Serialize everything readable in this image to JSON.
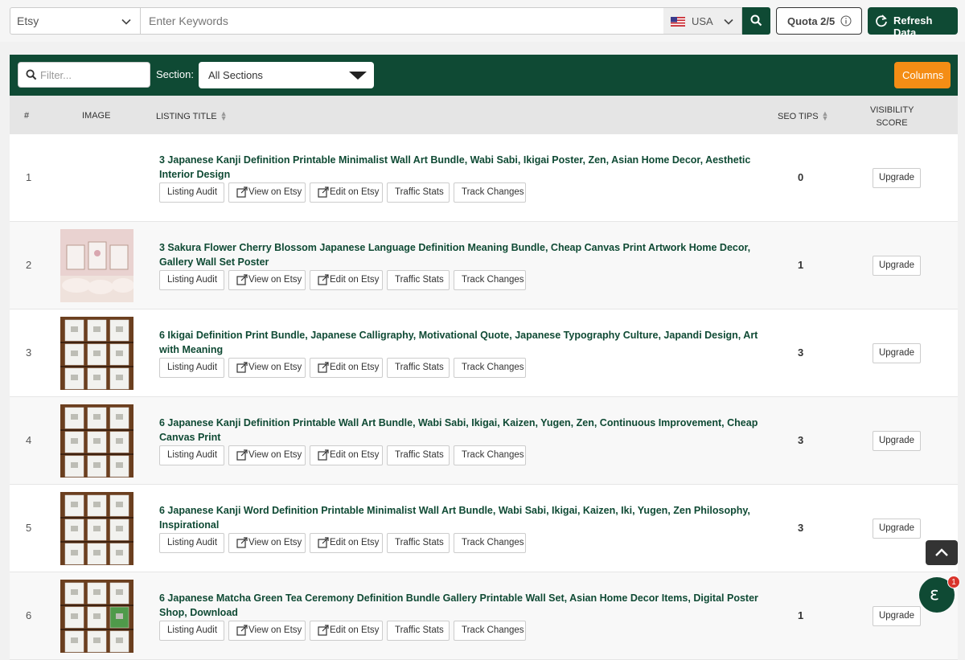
{
  "search": {
    "platform": "Etsy",
    "keyword_placeholder": "Enter Keywords",
    "country": "USA",
    "quota": "Quota 2/5",
    "refresh_label": "Refresh Data"
  },
  "toolbar": {
    "filter_placeholder": "Filter...",
    "section_label": "Section:",
    "section_value": "All Sections",
    "columns_label": "Columns"
  },
  "table": {
    "headers": {
      "num": "#",
      "image": "IMAGE",
      "title": "LISTING TITLE",
      "seo": "SEO TIPS",
      "visibility_line1": "VISIBILITY",
      "visibility_line2": "SCORE"
    },
    "button_labels": {
      "audit": "Listing Audit",
      "view": "View on Etsy",
      "edit": "Edit on Etsy",
      "traffic": "Traffic Stats",
      "track": "Track Changes",
      "upgrade": "Upgrade"
    },
    "rows": [
      {
        "num": "1",
        "title": "3 Japanese Kanji Definition Printable Minimalist Wall Art Bundle, Wabi Sabi, Ikigai Poster, Zen, Asian Home Decor, Aesthetic Interior Design",
        "seo": "0",
        "image": "none"
      },
      {
        "num": "2",
        "title": "3 Sakura Flower Cherry Blossom Japanese Language Definition Meaning Bundle, Cheap Canvas Print Artwork Home Decor, Gallery Wall Set Poster",
        "seo": "1",
        "image": "pink-room"
      },
      {
        "num": "3",
        "title": "6 Ikigai Definition Print Bundle, Japanese Calligraphy, Motivational Quote, Japanese Typography Culture, Japandi Design, Art with Meaning",
        "seo": "3",
        "image": "shelf-prints"
      },
      {
        "num": "4",
        "title": "6 Japanese Kanji Definition Printable Wall Art Bundle, Wabi Sabi, Ikigai, Kaizen, Yugen, Zen, Continuous Improvement, Cheap Canvas Print",
        "seo": "3",
        "image": "shelf-prints"
      },
      {
        "num": "5",
        "title": "6 Japanese Kanji Word Definition Printable Minimalist Wall Art Bundle, Wabi Sabi, Ikigai, Kaizen, Iki, Yugen, Zen Philosophy, Inspirational",
        "seo": "3",
        "image": "shelf-prints"
      },
      {
        "num": "6",
        "title": "6 Japanese Matcha Green Tea Ceremony Definition Bundle Gallery Printable Wall Set, Asian Home Decor Items, Digital Poster Shop, Download",
        "seo": "1",
        "image": "shelf-green"
      }
    ]
  },
  "chat": {
    "badge": "1"
  },
  "colors": {
    "brand_green": "#0f4a34",
    "accent_orange": "#f48d15"
  }
}
